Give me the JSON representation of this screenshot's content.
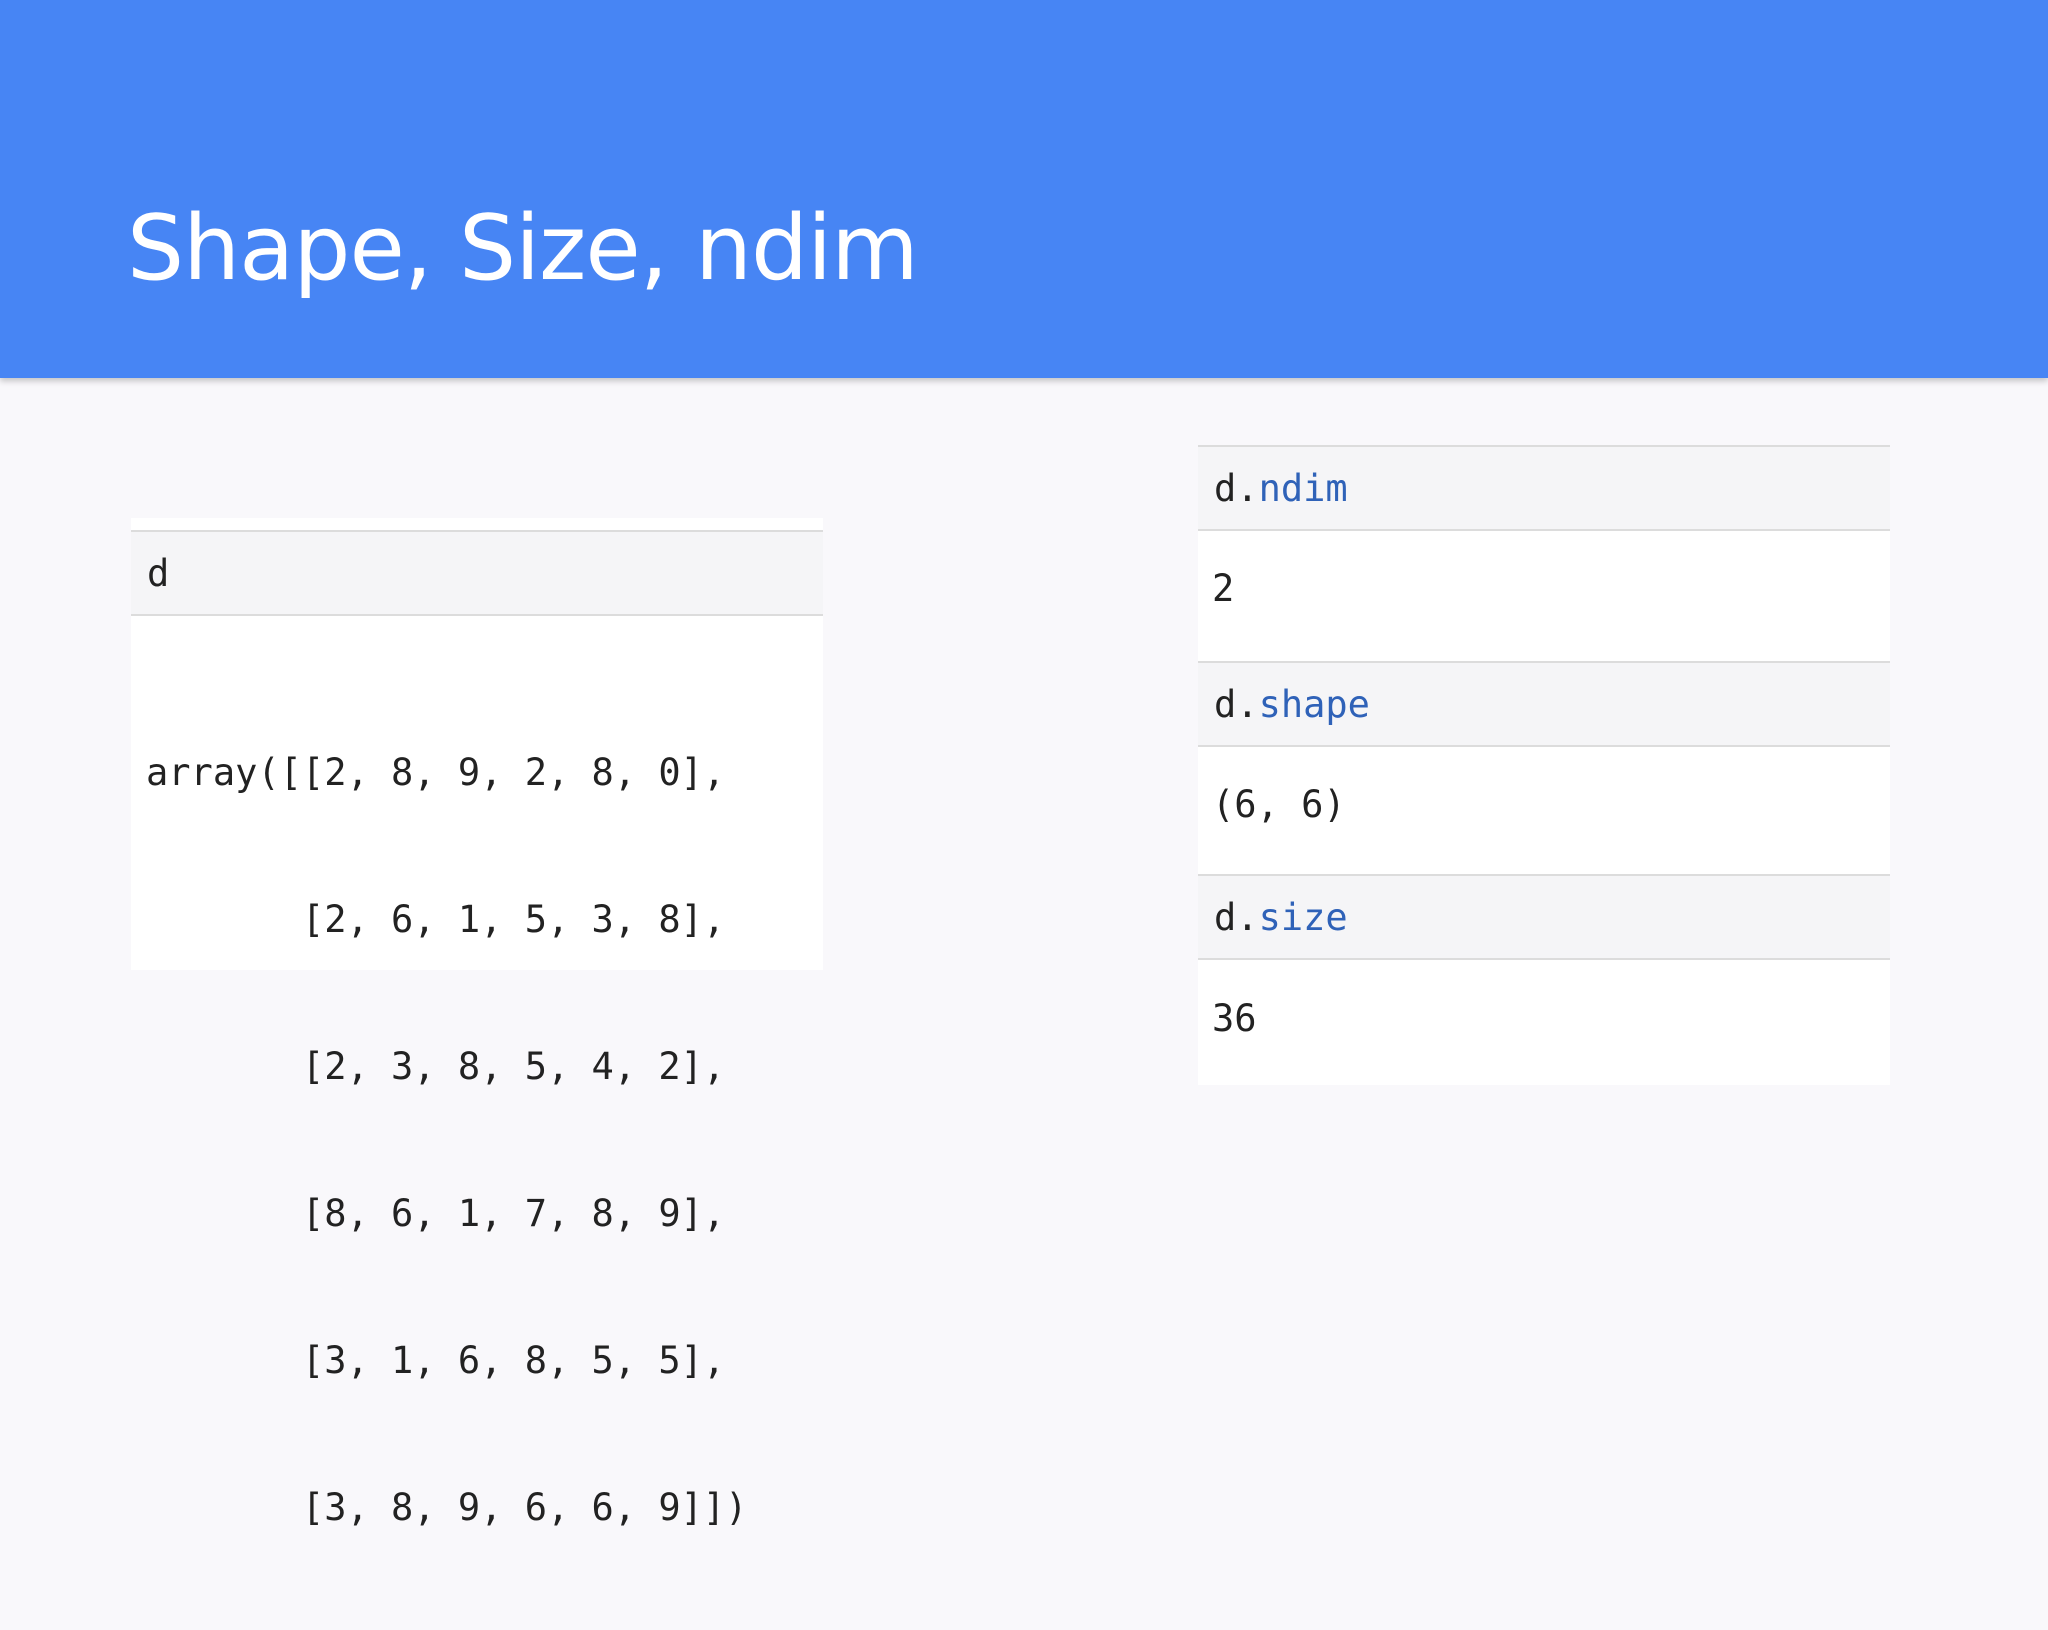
{
  "slide": {
    "title": "Shape, Size, ndim"
  },
  "left_cell": {
    "input": "d",
    "output_lines": [
      "array([[2, 8, 9, 2, 8, 0],",
      "       [2, 6, 1, 5, 3, 8],",
      "       [2, 3, 8, 5, 4, 2],",
      "       [8, 6, 1, 7, 8, 9],",
      "       [3, 1, 6, 8, 5, 5],",
      "       [3, 8, 9, 6, 6, 9]])"
    ]
  },
  "right_cells": [
    {
      "var": "d.",
      "attr": "ndim",
      "output": "2"
    },
    {
      "var": "d.",
      "attr": "shape",
      "output": "(6, 6)"
    },
    {
      "var": "d.",
      "attr": "size",
      "output": "36"
    }
  ],
  "colors": {
    "header_bg": "#4785f4",
    "attribute_text": "#2f62b8"
  }
}
